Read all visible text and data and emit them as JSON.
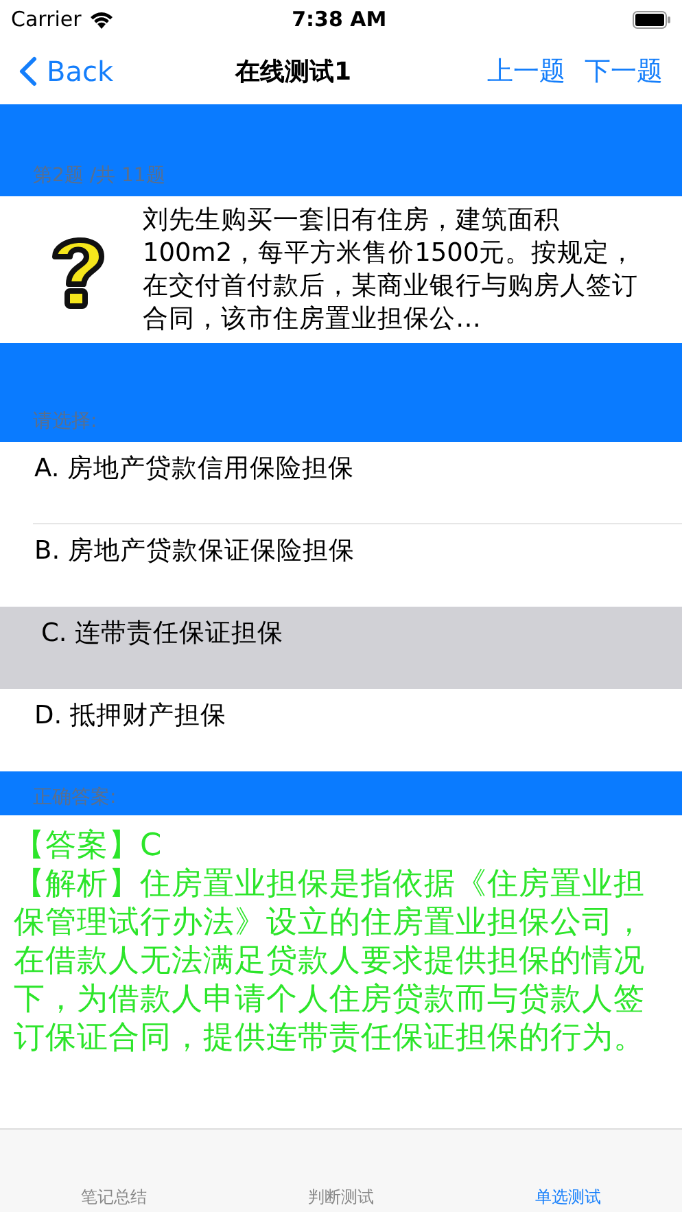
{
  "status_bar": {
    "carrier": "Carrier",
    "time": "7:38 AM"
  },
  "nav": {
    "back": "Back",
    "title": "在线测试1",
    "prev": "上一题",
    "next": "下一题"
  },
  "progress": "第2题 /共 11题",
  "question": "刘先生购买一套旧有住房，建筑面积100m2，每平方米售价1500元。按规定，在交付首付款后，某商业银行与购房人签订合同，该市住房置业担保公…",
  "choose_label": "请选择:",
  "options": [
    {
      "text": "A.   房地产贷款信用保险担保",
      "selected": false
    },
    {
      "text": "B.   房地产贷款保证保险担保",
      "selected": false
    },
    {
      "text": "C.   连带责任保证担保",
      "selected": true
    },
    {
      "text": "D.   抵押财产担保",
      "selected": false
    }
  ],
  "answer_label": "正确答案:",
  "answer": "【答案】C",
  "explanation": "【解析】住房置业担保是指依据《住房置业担保管理试行办法》设立的住房置业担保公司，在借款人无法满足贷款人要求提供担保的情况下，为借款人申请个人住房贷款而与贷款人签订保证合同，提供连带责任保证担保的行为。",
  "tabs": [
    {
      "label": "笔记总结",
      "selected": false
    },
    {
      "label": "判断测试",
      "selected": false
    },
    {
      "label": "单选测试",
      "selected": true
    }
  ]
}
